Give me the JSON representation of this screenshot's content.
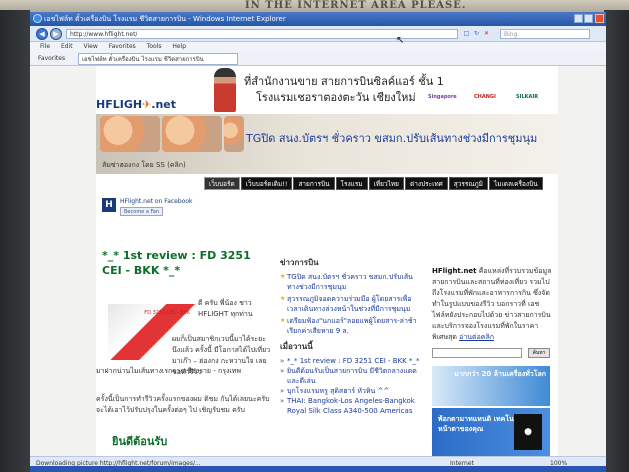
{
  "room": {
    "sign": "IN THE INTERNET AREA PLEASE."
  },
  "window": {
    "title": "เอชไฟล์ท ตั๋วเครื่องบิน โรงแรม ชีวิตสายการบิน - Windows Internet Explorer",
    "url": "http://www.hflight.net/",
    "search_placeholder": "Bing",
    "favorites_label": "Favorites",
    "tab_title": "เอชไฟล์ท ตั๋วเครื่องบิน โรงแรม ชีวิตสายการบิน"
  },
  "menu": [
    "File",
    "Edit",
    "View",
    "Favorites",
    "Tools",
    "Help"
  ],
  "banner": {
    "line1": "ที่สำนักงานขาย สายการบินซิลค์แอร์ ชั้น 1",
    "line2": "โรงแรมเชอราตองตะวัน เชียงใหม่",
    "partners": [
      "Singapore",
      "CHANGI",
      "SILKAIR"
    ]
  },
  "header": {
    "headline": "TGปิด สนง.บัตรฯ ชั่วคราว ขสมก.ปรับเส้นทางช่วงมีการชุมนุม",
    "ticker": "ลัมซ่าฮองกง โดย SS (คลิก)"
  },
  "nav": [
    "เว็บบอร์ด",
    "เว็บบอร์ดเดิม!!",
    "สายการบิน",
    "โรงแรม",
    "เที่ยวไทย",
    "ต่างประเทศ",
    "สุวรรณภูมิ",
    "ไมเดลเครื่องบิน"
  ],
  "facebook": {
    "label": "HFlight.net on Facebook",
    "button": "Become a Fan"
  },
  "main": {
    "post_title": "*_* 1st review : FD 3251 CEI - BKK *_*",
    "image_caption": "FD 3251 CEI - BKK",
    "text1": "ดี ครับ พี่น้อง ชาว HFLIGHT ทุกท่าน",
    "text2": "ผมก็เป็นสมาชิกเวบนี้มาได้ระยะนึงแล้ว ครั้งนี้ มีโอกาสได้ไปเที่ยวมาเก๊า – ฮ่องกง กะหวานใจ เลยขอทำรีวิว",
    "text3": "มาฝากน่านไมเส้นทางเรกจากเชียงราย - กรุงเทพ",
    "text4": "ครั้งนี้เป็นการทำรีวิวครั้งแรกของผม ติชม กันได้เลยนะครับ จะได้เอาไว้ปรับปรุงในครั้งต่อๆ ไป เชิญรับชม ครับ",
    "post_title2": "ยินดีต้อนรับ"
  },
  "news": {
    "heading": "ข่าวการบิน",
    "items": [
      "TGปิด สนง.บัตรฯ ชั่วคราว ขสมก.ปรับเส้นทางช่วงมีการชุมนุม",
      "สุวรรณภูมิจอดความร่วมมือ ผู้โดยสารเพื่อเวลาเดินทางล่วงหน้าในช่วงที่มีการชุมนุม",
      "เตรียมฟ้อง\"นกแอร์\"ลอยแพผู้โดยสาร-ล่าช้าเรียกค่าเสียหาย 9 ล."
    ]
  },
  "latest": {
    "heading": "เมื่อวานนี้",
    "items": [
      "*_* 1st review : FD 3251 CEI - BKK *_*",
      "ยินดีต้อนรับเป็นสายการบิน มีชีวิตกลางแดดและดีเล่น",
      "บุกโรงแรมหรู สุดิสฮาร์ หัวหิน ^^",
      "THAI: Bangkok-Los Angeles-Bangkok Royal Silk Class A340-500 Americas"
    ]
  },
  "about": {
    "brand": "HFlight.net",
    "body": "คือแหล่งที่รวบรวมข้อมูลสายการบินและสถานที่ท่องเที่ยว รวมไปถึงโรงแรมที่พักและอาหารการกิน ซึ่งจัดทำในรูปแบบของรีวิว บอกราวที่ เอชไฟล์ทยังประกอบไปด้วย ข่าวสายการบิน และบริการจองโรงแรมที่พักในราคาพิเศษสุด",
    "more": "อ่านต่อคลิก",
    "search_button": "ค้นหา"
  },
  "ads": {
    "ad1": "มากกว่า 20 ล้านเครื่องทั่วโลก",
    "ad2": "พ้อกตามาทแหนดิ เทคโนโลยี หน้าตาของคุณ"
  },
  "status": {
    "text": "Downloading picture http://hflight.net/forum/images/...",
    "zone": "Internet",
    "zoom": "100%"
  }
}
